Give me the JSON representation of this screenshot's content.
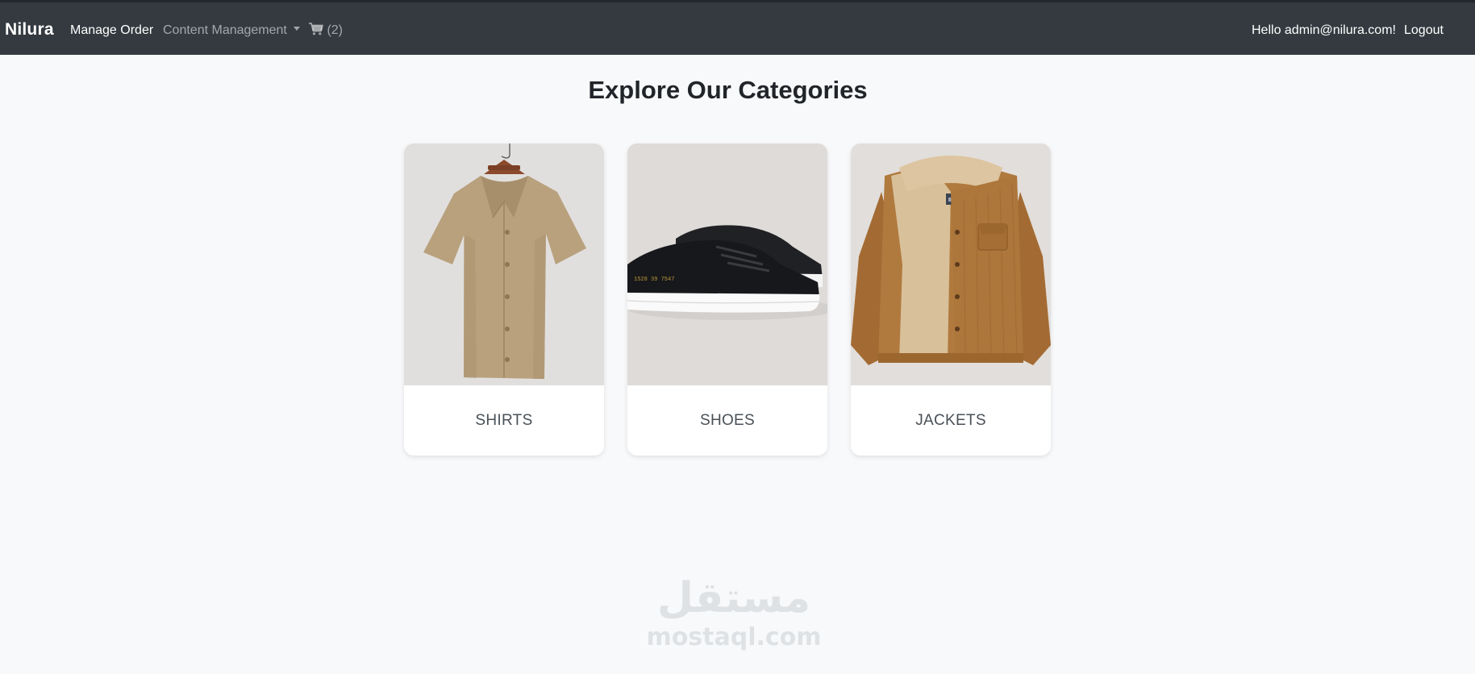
{
  "navbar": {
    "brand": "Nilura",
    "manage_order": "Manage Order",
    "content_management": "Content Management",
    "cart_count": "(2)",
    "greeting": "Hello admin@nilura.com!",
    "logout": "Logout"
  },
  "main": {
    "title": "Explore Our Categories",
    "categories": [
      {
        "label": "SHIRTS",
        "icon": "shirt-image"
      },
      {
        "label": "SHOES",
        "icon": "sneaker-image"
      },
      {
        "label": "JACKETS",
        "icon": "jacket-image"
      }
    ]
  },
  "watermark": {
    "arabic": "مستقل",
    "latin": "mostaql.com"
  },
  "colors": {
    "navbar_bg": "#343a40",
    "page_bg": "#f8f9fa",
    "title": "#212529",
    "card_label": "#495057"
  }
}
